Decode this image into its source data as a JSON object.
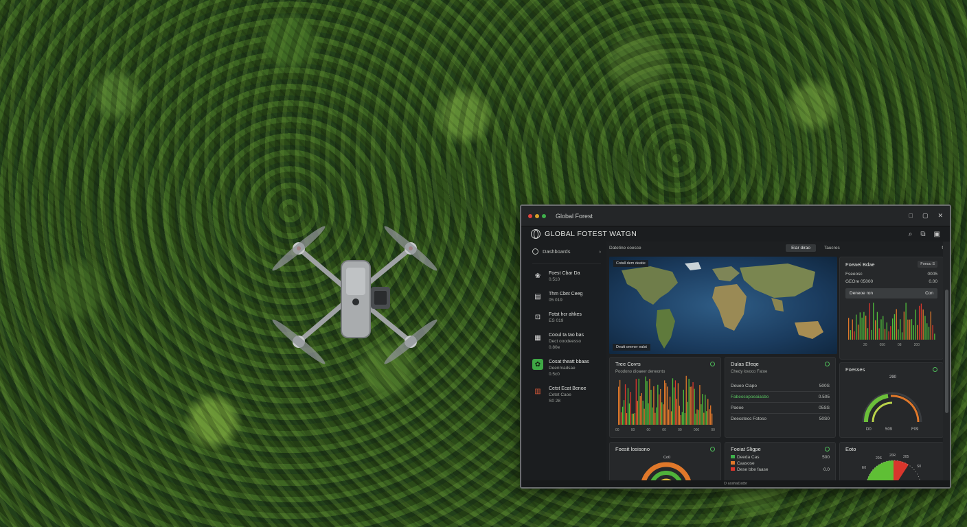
{
  "window": {
    "title": "Global Forest",
    "controls": [
      "□",
      "▢",
      "✕"
    ]
  },
  "app": {
    "title": "GLOBAL FOTEST WATGN",
    "icons": [
      "search-icon",
      "share-icon",
      "save-icon"
    ]
  },
  "sidebar": {
    "header": "Dashboards",
    "items": [
      {
        "line1": "Foest Cbar Da",
        "line2": "0.510",
        "line3": ""
      },
      {
        "line1": "Thm Cbnt Ceeg",
        "line2": "05 019",
        "line3": ""
      },
      {
        "line1": "Fotst hcr ahkes",
        "line2": "ES 019",
        "line3": ""
      },
      {
        "line1": "Cooul ta tao bas",
        "line2": "Dect ooodeesso",
        "line3": "0.80e"
      },
      {
        "line1": "Cosat theatt bbaas",
        "line2": "Deenmadsae",
        "line3": "0.5c0"
      },
      {
        "line1": "Cetst Ecat Benoe",
        "line2": "Cetet Caoe",
        "line3": "S0 28"
      }
    ]
  },
  "main": {
    "crumb": "Datetine coesce",
    "tabs": [
      "Elar dirao",
      "Taucres"
    ],
    "map_label": "Cotall dem deatie",
    "map_footer": "Deatt ommer ealst"
  },
  "panels": {
    "forest_data": {
      "title": "Foeaei Bdae",
      "pill": "Foeuu S",
      "rows": [
        {
          "k": "Fseeosc",
          "v": "0005"
        },
        {
          "k": "GEOre 05000",
          "v": "0.00"
        }
      ],
      "button": {
        "label": "Deneoe ron",
        "value": "Con"
      },
      "axis": [
        "20",
        "050",
        "08",
        "200"
      ]
    },
    "tree_cover": {
      "title": "Tree Covrs",
      "sub": "Poodono dioaeer deneonto",
      "axis": [
        "00",
        "00",
        "00",
        "00",
        "00",
        "000",
        "00"
      ]
    },
    "globe_stage": {
      "title": "Dulas Efeqe",
      "sub": "Chedy lovoco Fatoe",
      "rows": [
        {
          "k": "Deueo Clapo",
          "v": "500S",
          "green": false
        },
        {
          "k": "Fabeosopoeaiasbo",
          "v": "0.505",
          "green": true
        },
        {
          "k": "Paeoe",
          "v": "05SS",
          "green": false
        },
        {
          "k": "Deecstecc Fotoso",
          "v": "50S0",
          "green": false
        }
      ]
    },
    "fosses": {
      "title": "Foesses",
      "top": "290",
      "ticks": [
        "D0",
        "509",
        "F09"
      ]
    },
    "forest_bottom": {
      "title": "Foesit losisono",
      "top": "Co0"
    },
    "forest_status": {
      "title": "Foeiat Sligpe",
      "rows": [
        {
          "k": "Deeda Cas",
          "v": "500"
        },
        {
          "k": "Caasose",
          "v": ""
        },
        {
          "k": "Dese bbe faase",
          "v": "0.0"
        }
      ]
    },
    "eoto": {
      "title": "Eoto",
      "ticks": [
        "E0",
        "20S",
        "20R",
        "205",
        "S0"
      ]
    }
  },
  "status": "D asshaDatbr",
  "colors": {
    "accent_green": "#3fb04b",
    "accent_orange": "#e0782a",
    "accent_red": "#d9362c"
  }
}
